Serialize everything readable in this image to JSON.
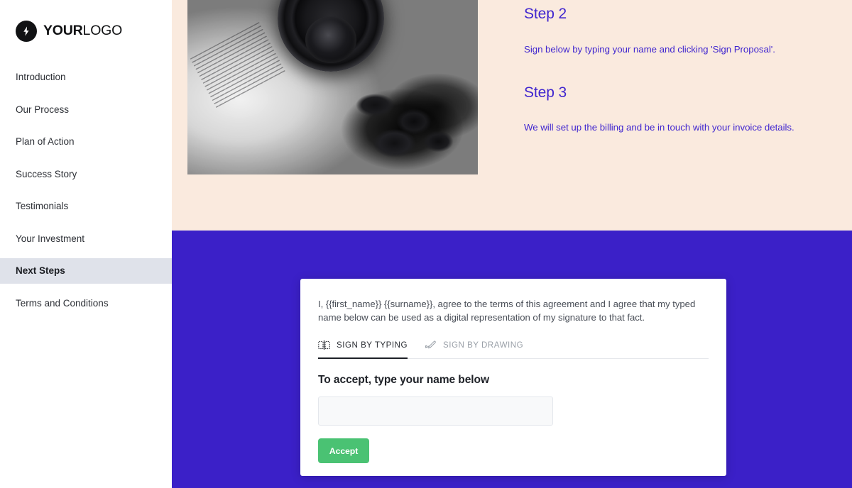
{
  "brand": {
    "logo_icon": "lightning-bolt-icon",
    "logo_bold": "YOUR",
    "logo_light": "LOGO",
    "logo_mark_color": "#111214"
  },
  "sidebar": {
    "items": [
      {
        "label": "Introduction",
        "active": false
      },
      {
        "label": "Our Process",
        "active": false
      },
      {
        "label": "Plan of Action",
        "active": false
      },
      {
        "label": "Success Story",
        "active": false
      },
      {
        "label": "Testimonials",
        "active": false
      },
      {
        "label": "Your Investment",
        "active": false
      },
      {
        "label": "Next Steps",
        "active": true
      },
      {
        "label": "Terms and Conditions",
        "active": false
      }
    ],
    "active_background": "#dfe2ea"
  },
  "hero": {
    "image_alt": "black-and-white photo of a camera lens resting on an open book",
    "background_color": "#faeade"
  },
  "steps": [
    {
      "heading": "Step 2",
      "body": "Sign below by typing your name and clicking 'Sign Proposal'."
    },
    {
      "heading": "Step 3",
      "body": "We will set up the billing and be in touch with your invoice details."
    }
  ],
  "signature_section": {
    "background_color": "#3b20c8",
    "card": {
      "agreement_text": "I, {{first_name}} {{surname}}, agree to the terms of this agreement and I agree that my typed name below can be used as a digital representation of my signature to that fact.",
      "tabs": [
        {
          "label": "SIGN BY TYPING",
          "icon": "keyboard-icon",
          "active": true
        },
        {
          "label": "SIGN BY DRAWING",
          "icon": "pen-signature-icon",
          "active": false
        }
      ],
      "accept_title": "To accept, type your name below",
      "name_input": {
        "value": "",
        "placeholder": ""
      },
      "accept_button": {
        "label": "Accept",
        "color": "#4ac273"
      }
    }
  },
  "theme": {
    "accent_purple": "#4026cf",
    "band_purple": "#3b20c8",
    "beige": "#faeade",
    "green": "#4ac273"
  }
}
